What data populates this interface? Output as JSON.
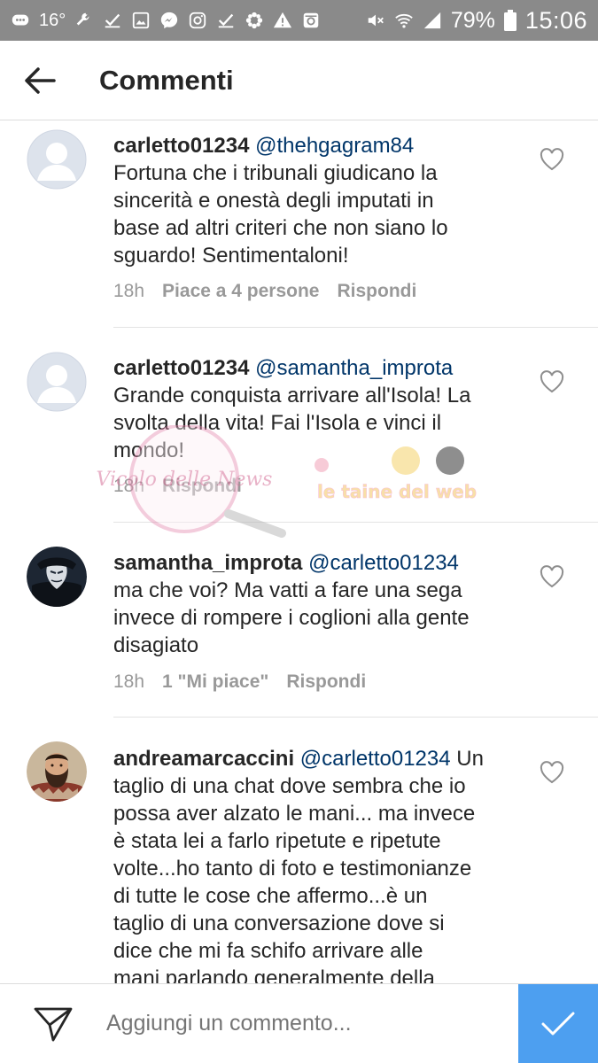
{
  "status_bar": {
    "temperature": "16°",
    "battery_percent": "79%",
    "time": "15:06"
  },
  "header": {
    "title": "Commenti"
  },
  "comments": [
    {
      "username": "carletto01234",
      "mention": "@thehgagram84",
      "text_lines": [
        "Fortuna che i tribunali giudicano la",
        "sincerità e onestà degli imputati in",
        "base ad altri criteri che non siano lo",
        "sguardo! Sentimentaloni!"
      ],
      "time": "18h",
      "likes": "Piace a 4 persone",
      "reply": "Rispondi",
      "avatar_icon": "default-avatar-icon"
    },
    {
      "username": "carletto01234",
      "mention": "@samantha_improta",
      "text_lines": [
        "Grande conquista arrivare all'Isola! La",
        "svolta della vita! Fai l'Isola e vinci il",
        "mondo!"
      ],
      "time": "18h",
      "likes": "",
      "reply": "Rispondi",
      "avatar_icon": "default-avatar-icon"
    },
    {
      "username": "samantha_improta",
      "mention": "@carletto01234",
      "text_lines": [
        "ma che voi? Ma vatti a fare una sega",
        "invece di rompere i coglioni alla gente",
        "disagiato"
      ],
      "time": "18h",
      "likes": "1 \"Mi piace\"",
      "reply": "Rispondi",
      "avatar_icon": "masked-face-avatar"
    },
    {
      "username": "andreamarcaccini",
      "mention": "@carletto01234",
      "first_line_rest": "Un",
      "text_lines": [
        "taglio di una chat dove sembra che io",
        "possa aver alzato le mani... ma invece",
        "è stata lei a farlo ripetute e ripetute",
        "volte...ho tanto di foto e testimonianze",
        "di tutte le cose che affermo...è un",
        "taglio di una conversazione dove si",
        "dice che mi fa schifo arrivare alle",
        "mani parlando generalmente della"
      ],
      "avatar_icon": "bearded-man-avatar"
    }
  ],
  "watermark": {
    "script_text": "Vicolo delle News",
    "banner_text": "le taine del web"
  },
  "footer": {
    "placeholder": "Aggiungi un commento..."
  },
  "colors": {
    "status_bar": "#8a8a8a",
    "mention": "#003569",
    "meta": "#999999",
    "post_button": "#4d9ff0"
  }
}
